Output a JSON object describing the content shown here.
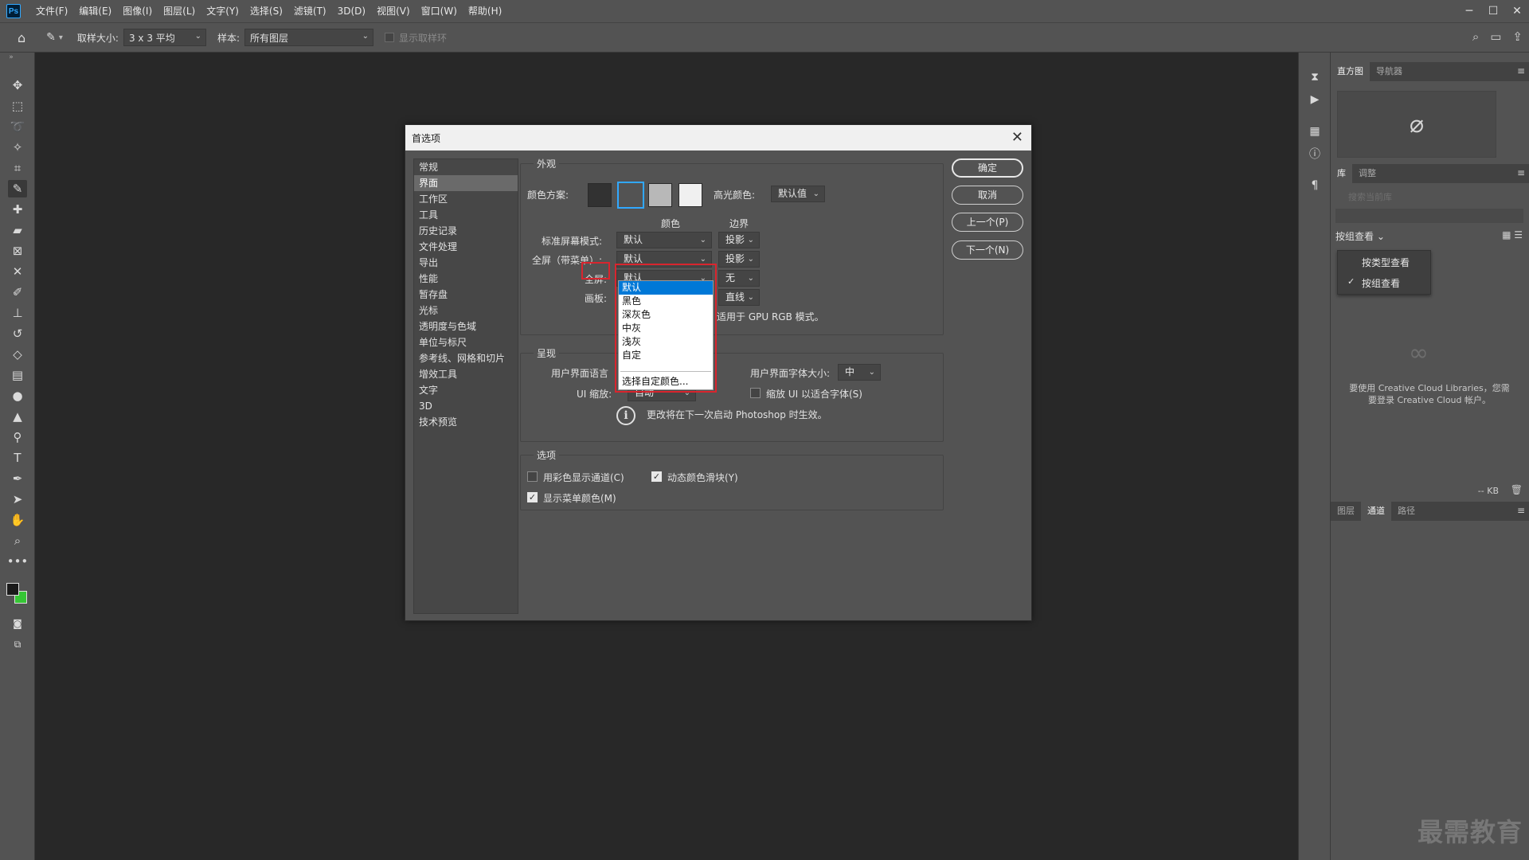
{
  "app": {
    "logo": "Ps"
  },
  "menu": [
    "文件(F)",
    "编辑(E)",
    "图像(I)",
    "图层(L)",
    "文字(Y)",
    "选择(S)",
    "滤镜(T)",
    "3D(D)",
    "视图(V)",
    "窗口(W)",
    "帮助(H)"
  ],
  "window_controls": {
    "minimize": "─",
    "restore": "☐",
    "close": "✕"
  },
  "options_bar": {
    "sample_size_label": "取样大小:",
    "sample_size_value": "3 x 3 平均",
    "sample_label": "样本:",
    "sample_value": "所有图层",
    "show_ring_label": "显示取样环"
  },
  "right_panels": {
    "top_tabs": [
      "直方图",
      "导航器"
    ],
    "lib_tabs": [
      "库",
      "调整"
    ],
    "search_placeholder": "搜索当前库",
    "group_view_label": "按组查看 ⌄",
    "view_menu": [
      "按类型查看",
      "按组查看"
    ],
    "view_menu_checked": "✓",
    "cc_message": "要使用 Creative Cloud Libraries，您需要登录 Creative Cloud 帐户。",
    "kb_label": "-- KB",
    "bottom_tabs": [
      "图层",
      "通道",
      "路径"
    ]
  },
  "dialog": {
    "title": "首选项",
    "close": "✕",
    "categories": [
      "常规",
      "界面",
      "工作区",
      "工具",
      "历史记录",
      "文件处理",
      "导出",
      "性能",
      "暂存盘",
      "光标",
      "透明度与色域",
      "单位与标尺",
      "参考线、网格和切片",
      "增效工具",
      "文字",
      "3D",
      "技术预览"
    ],
    "selected_category": "界面",
    "buttons": {
      "ok": "确定",
      "cancel": "取消",
      "prev": "上一个(P)",
      "next": "下一个(N)"
    },
    "appearance": {
      "group_title": "外观",
      "color_scheme_label": "颜色方案:",
      "swatch_colors": [
        "#323232",
        "#535353",
        "#b8b8b8",
        "#f0f0f0"
      ],
      "highlight_label": "高光颜色:",
      "highlight_value": "默认值",
      "col_color": "颜色",
      "col_border": "边界",
      "rows": [
        {
          "label": "标准屏幕模式:",
          "color": "默认",
          "border": "投影"
        },
        {
          "label": "全屏（带菜单）:",
          "color": "默认",
          "border": "投影"
        },
        {
          "label": "全屏:",
          "color": "默认",
          "border": "无"
        },
        {
          "label": "画板:",
          "color": "",
          "border": "直线"
        }
      ],
      "gpu_note": "适用于 GPU RGB 模式。"
    },
    "presentation": {
      "group_title": "呈现",
      "ui_lang_label": "用户界面语言",
      "ui_font_label": "用户界面字体大小:",
      "ui_font_value": "中",
      "ui_scale_label": "UI 缩放:",
      "ui_scale_value": "自动",
      "scale_check_label": "缩放 UI 以适合字体(S)",
      "restart_note": "更改将在下一次启动 Photoshop 时生效。"
    },
    "options": {
      "group_title": "选项",
      "color_channels_label": "用彩色显示通道(C)",
      "dynamic_sliders_label": "动态颜色滑块(Y)",
      "menu_colors_label": "显示菜单颜色(M)"
    },
    "dropdown": {
      "items": [
        "默认",
        "黑色",
        "深灰色",
        "中灰",
        "浅灰",
        "自定"
      ],
      "highlighted": "默认",
      "custom_label": "选择自定颜色..."
    }
  },
  "watermark": "最需教育",
  "colors": {
    "accent_blue": "#31a8ff",
    "highlight_red": "#d9252e",
    "dropdown_select": "#0078d7"
  }
}
